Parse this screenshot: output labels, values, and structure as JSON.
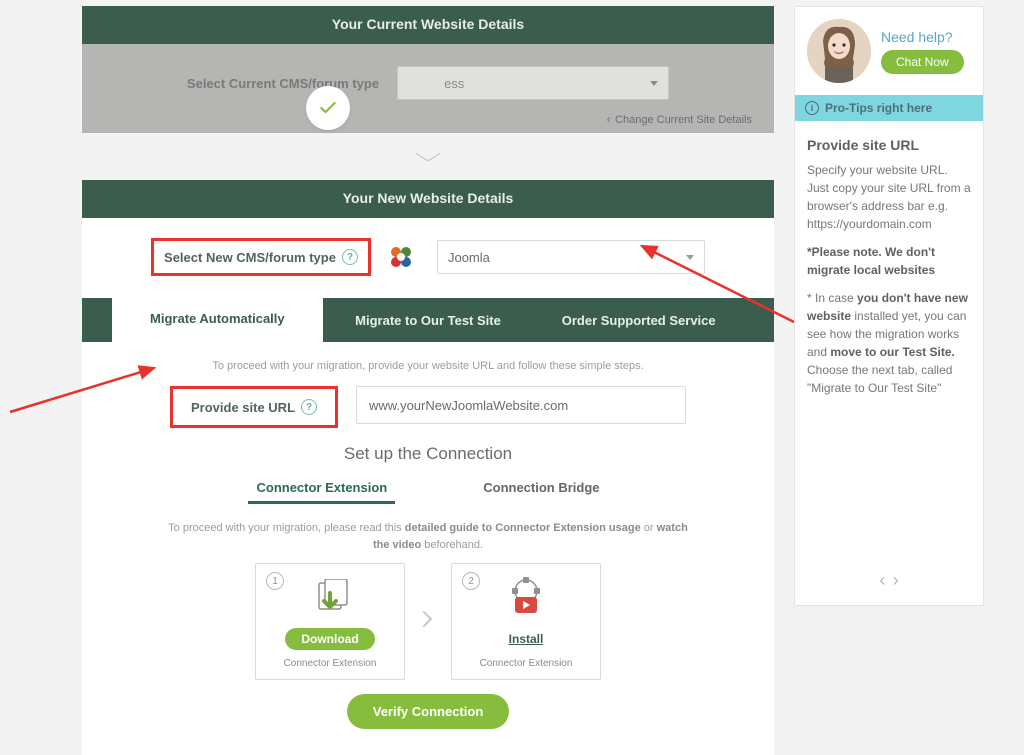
{
  "section1": {
    "title": "Your Current Website Details",
    "label": "Select Current CMS/forum type",
    "select_display": "ess",
    "change_link": "Change Current Site Details"
  },
  "section2": {
    "title": "Your New Website Details",
    "label": "Select New CMS/forum type",
    "select_value": "Joomla",
    "tabs": [
      "Migrate Automatically",
      "Migrate to Our Test Site",
      "Order Supported Service"
    ],
    "active_tab": 0,
    "instruction": "To proceed with your migration, provide your website URL and follow these simple steps.",
    "url_label": "Provide site URL",
    "url_value": "www.yourNewJoomlaWebsite.com",
    "setup_title": "Set up the Connection",
    "subtabs": [
      "Connector Extension",
      "Connection Bridge"
    ],
    "active_subtab": 0,
    "guide_pre": "To proceed with your migration, please read this ",
    "guide_link1": "detailed guide to Connector Extension usage",
    "guide_mid": " or ",
    "guide_link2": "watch the video",
    "guide_post": " beforehand.",
    "card1_action": "Download",
    "card1_caption": "Connector Extension",
    "card2_action": "Install",
    "card2_caption": "Connector Extension",
    "verify_btn": "Verify Connection"
  },
  "sidebar": {
    "need_help": "Need help?",
    "chat_now": "Chat Now",
    "protips": "Pro-Tips right here",
    "heading": "Provide site URL",
    "p1": "Specify your website URL. Just copy your site URL from a browser's address bar e.g. https://yourdomain.com",
    "note_bold": "*Please note. We don't migrate local websites",
    "p2_pre": "* In case ",
    "p2_b1": "you don't have new website",
    "p2_mid": " installed yet, you can see how the migration works and ",
    "p2_b2": "move to our Test Site.",
    "p2_post": " Choose the next tab, called \"Migrate to Our Test Site\""
  }
}
